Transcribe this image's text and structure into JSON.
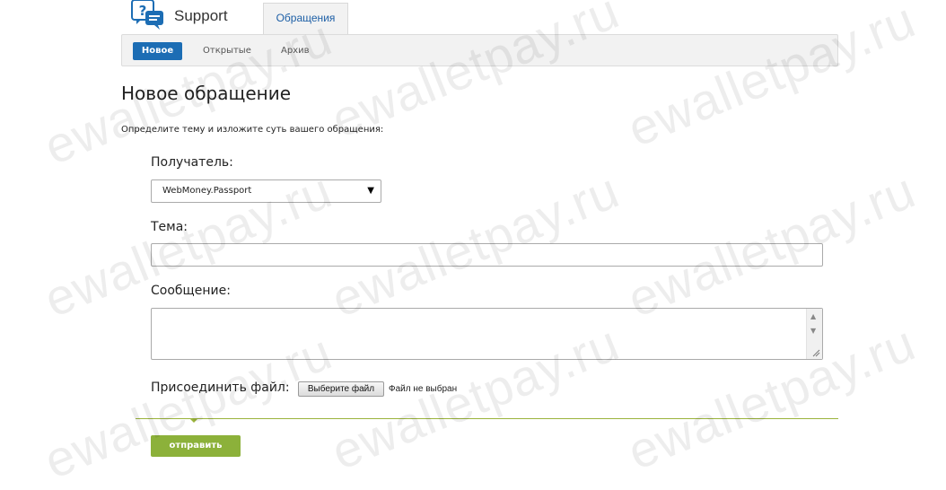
{
  "header": {
    "brand": "Support",
    "tab": "Обращения"
  },
  "subnav": {
    "items": [
      {
        "label": "Новое"
      },
      {
        "label": "Открытые"
      },
      {
        "label": "Архив"
      }
    ]
  },
  "page": {
    "title": "Новое обращение",
    "intro": "Определите тему и изложите суть вашего обращения:"
  },
  "form": {
    "recipient_label": "Получатель:",
    "recipient_value": "WebMoney.Passport",
    "subject_label": "Тема:",
    "subject_value": "",
    "message_label": "Сообщение:",
    "message_value": "",
    "attach_label": "Присоединить файл:",
    "file_button": "Выберите файл",
    "file_status": "Файл не выбран",
    "submit": "отправить"
  },
  "watermark": "ewalletpay.ru",
  "colors": {
    "primary": "#1c6db4",
    "submit": "#8cb13a",
    "divider": "#9bb43c"
  },
  "icons": {
    "logo": "support-chat-icon",
    "dropdown": "triangle-down-icon"
  }
}
